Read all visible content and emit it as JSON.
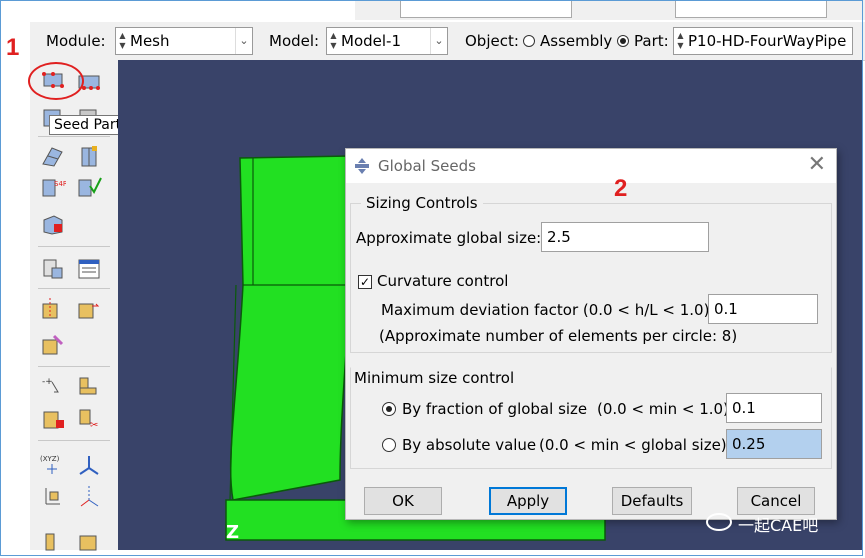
{
  "annotations": {
    "step1": "1",
    "step2": "2"
  },
  "context_bar": {
    "module_label": "Module:",
    "module_value": "Mesh",
    "model_label": "Model:",
    "model_value": "Model-1",
    "object_label": "Object:",
    "assembly_label": "Assembly",
    "part_label": "Part:",
    "part_value": "P10-HD-FourWayPipe",
    "object_selected": "Part"
  },
  "toolbox": {
    "tooltip": "Seed Part",
    "icons": [
      "seed-part-icon",
      "seed-edges-icon",
      "seed-delete-icon",
      "seed-edge-biased-icon",
      "mesh-controls-icon",
      "element-type-icon",
      "mesh-part-icon",
      "verify-mesh-icon",
      "mesh-region-icon",
      "assign-stack-icon",
      "query-icon",
      "mesh-stats-icon",
      "partition-cell-icon",
      "partition-face-icon",
      "virtual-topology-icon",
      "datum-point-icon",
      "datum-axis-icon",
      "datum-plane-icon",
      "datum-csys-icon",
      "edit-mesh-icon",
      "mesh-edit-icon"
    ]
  },
  "viewport": {
    "triad_label": "Z",
    "part_color": "#20e020",
    "background": "#394369"
  },
  "dialog": {
    "title": "Global Seeds",
    "close_symbol": "✕",
    "sizing_group": "Sizing Controls",
    "approx_size_label": "Approximate global size:",
    "approx_size_value": "2.5",
    "curvature_label": "Curvature control",
    "curvature_checked": true,
    "max_dev_label": "Maximum deviation factor (0.0 < h/L < 1.0):",
    "max_dev_value": "0.1",
    "approx_elements_note": "(Approximate number of elements per circle: 8)",
    "min_size_group": "Minimum size control",
    "by_fraction_label": "By fraction of global size",
    "by_fraction_range": "(0.0 < min < 1.0)",
    "by_fraction_value": "0.1",
    "by_absolute_label": "By absolute value",
    "by_absolute_range": "(0.0 < min < global size)",
    "by_absolute_value": "0.25",
    "selected_option": "By fraction of global size",
    "buttons": {
      "ok": "OK",
      "apply": "Apply",
      "defaults": "Defaults",
      "cancel": "Cancel"
    }
  },
  "watermark": {
    "text": "一起CAE吧"
  },
  "colors": {
    "accent_red": "#e02020",
    "highlight_field": "#b3d0ee",
    "frame_blue": "#5b9bd5"
  }
}
